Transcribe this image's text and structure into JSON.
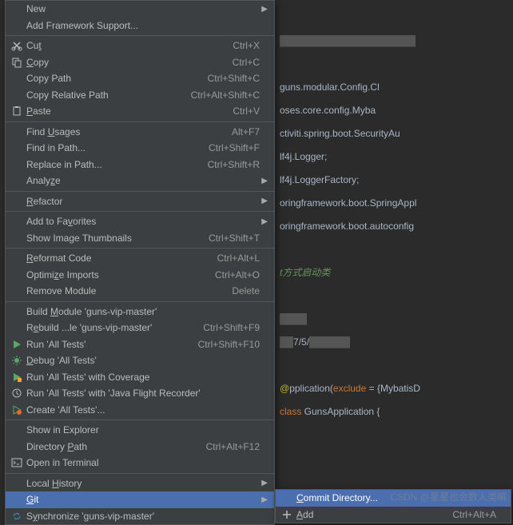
{
  "code": {
    "l1": "guns.modular.Config.Cl",
    "l2": "oses.core.config.Myba",
    "l3": "ctiviti.spring.boot.SecurityAu",
    "l4": "lf4j.Logger;",
    "l5": "lf4j.LoggerFactory;",
    "l6": "oringframework.boot.SpringAppl",
    "l7": "oringframework.boot.autoconfig",
    "l8": "t方式启动类",
    "l9": "7/5/",
    "l10a": "pplication",
    "l10b": "(",
    "l10c": "exclude",
    "l10d": " = {MybatisD",
    "l11a": " GunsApplication {",
    "ann": "@",
    "kw_class": "class"
  },
  "menu": [
    {
      "label": "New",
      "sub": true
    },
    {
      "label": "Add Framework Support..."
    },
    {
      "sep": true
    },
    {
      "icon": "cut",
      "label": "Cut",
      "u": "t",
      "pre": "Cu",
      "shortcut": "Ctrl+X"
    },
    {
      "icon": "copy",
      "label": "Copy",
      "u": "C",
      "post": "opy",
      "shortcut": "Ctrl+C"
    },
    {
      "label": "Copy Path",
      "shortcut": "Ctrl+Shift+C"
    },
    {
      "label": "Copy Relative Path",
      "shortcut": "Ctrl+Alt+Shift+C"
    },
    {
      "icon": "paste",
      "label": "Paste",
      "u": "P",
      "post": "aste",
      "shortcut": "Ctrl+V"
    },
    {
      "sep": true
    },
    {
      "label": "Find Usages",
      "u": "U",
      "pre": "Find ",
      "post": "sages",
      "shortcut": "Alt+F7"
    },
    {
      "label": "Find in Path...",
      "shortcut": "Ctrl+Shift+F"
    },
    {
      "label": "Replace in Path...",
      "shortcut": "Ctrl+Shift+R"
    },
    {
      "label": "Analyze",
      "u": "z",
      "pre": "Analy",
      "post": "e",
      "sub": true
    },
    {
      "sep": true
    },
    {
      "label": "Refactor",
      "u": "R",
      "post": "efactor",
      "sub": true
    },
    {
      "sep": true
    },
    {
      "label": "Add to Favorites",
      "u": "v",
      "pre": "Add to Fa",
      "post": "orites",
      "sub": true
    },
    {
      "label": "Show Image Thumbnails",
      "shortcut": "Ctrl+Shift+T"
    },
    {
      "sep": true
    },
    {
      "label": "Reformat Code",
      "u": "R",
      "post": "eformat Code",
      "shortcut": "Ctrl+Alt+L"
    },
    {
      "label": "Optimize Imports",
      "u": "z",
      "pre": "Optimi",
      "post": "e Imports",
      "shortcut": "Ctrl+Alt+O"
    },
    {
      "label": "Remove Module",
      "shortcut": "Delete"
    },
    {
      "sep": true
    },
    {
      "label": "Build Module 'guns-vip-master'",
      "u": "M",
      "pre": "Build ",
      "post": "odule 'guns-vip-master'"
    },
    {
      "label": "Rebuild ...le 'guns-vip-master'",
      "u": "e",
      "pre": "R",
      "post": "build ...le 'guns-vip-master'",
      "shortcut": "Ctrl+Shift+F9"
    },
    {
      "icon": "run",
      "label": "Run 'All Tests'",
      "shortcut": "Ctrl+Shift+F10"
    },
    {
      "icon": "debug",
      "label": "Debug 'All Tests'",
      "u": "D",
      "post": "ebug 'All Tests'"
    },
    {
      "icon": "coverage",
      "label": "Run 'All Tests' with Coverage"
    },
    {
      "icon": "jfr",
      "label": "Run 'All Tests' with 'Java Flight Recorder'"
    },
    {
      "icon": "create",
      "label": "Create 'All Tests'..."
    },
    {
      "sep": true
    },
    {
      "label": "Show in Explorer"
    },
    {
      "label": "Directory Path",
      "u": "P",
      "pre": "Directory ",
      "post": "ath",
      "shortcut": "Ctrl+Alt+F12"
    },
    {
      "icon": "terminal",
      "label": "Open in Terminal"
    },
    {
      "sep": true
    },
    {
      "label": "Local History",
      "u": "H",
      "pre": "Local ",
      "post": "istory",
      "sub": true
    },
    {
      "label": "Git",
      "u": "G",
      "post": "it",
      "sub": true,
      "sel": true
    },
    {
      "icon": "sync",
      "label": "Synchronize 'guns-vip-master'",
      "u": "y",
      "pre": "S",
      "post": "nchronize 'guns-vip-master'"
    }
  ],
  "submenu": [
    {
      "label": "Commit Directory...",
      "u": "C",
      "post": "ommit Directory...",
      "sel": true
    },
    {
      "icon": "plus",
      "label": "Add",
      "u": "A",
      "post": "dd",
      "shortcut": "Ctrl+Alt+A"
    }
  ],
  "watermark": "CSDN @星星也会数人类嘛"
}
